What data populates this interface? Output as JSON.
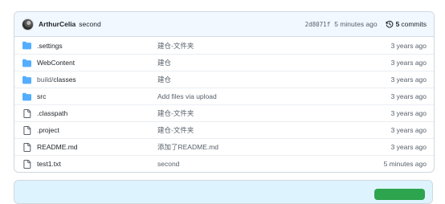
{
  "commit": {
    "author": "ArthurCelia",
    "message": "second",
    "sha": "2d8071f",
    "time": "5 minutes ago",
    "commit_count": "5",
    "commit_label": "commits"
  },
  "files": [
    {
      "type": "folder",
      "name": ".settings",
      "message": "建仓-文件夹",
      "age": "3 years ago"
    },
    {
      "type": "folder",
      "name": "WebContent",
      "message": "建仓",
      "age": "3 years ago"
    },
    {
      "type": "folder",
      "name": "build/classes",
      "name_prefix": "build/",
      "name_rest": "classes",
      "message": "建仓",
      "age": "3 years ago"
    },
    {
      "type": "folder",
      "name": "src",
      "message": "Add files via upload",
      "age": "3 years ago"
    },
    {
      "type": "file",
      "name": ".classpath",
      "message": "建仓-文件夹",
      "age": "3 years ago"
    },
    {
      "type": "file",
      "name": ".project",
      "message": "建仓-文件夹",
      "age": "3 years ago"
    },
    {
      "type": "file",
      "name": "README.md",
      "message": "添加了README.md",
      "age": "3 years ago"
    },
    {
      "type": "file",
      "name": "test1.txt",
      "message": "second",
      "age": "5 minutes ago"
    }
  ],
  "colors": {
    "folder": "#54aeff",
    "file": "#57606a",
    "link": "#1f2328"
  }
}
